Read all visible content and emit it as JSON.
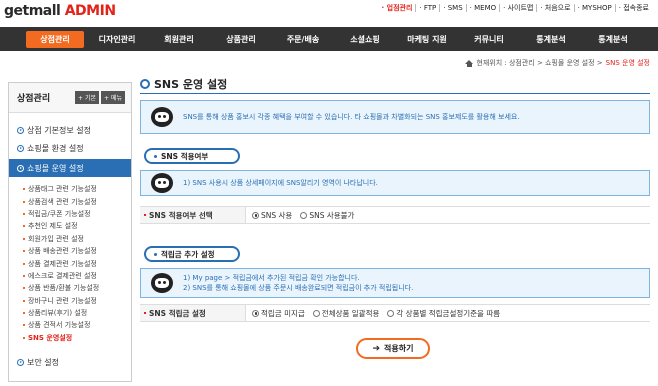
{
  "logo": {
    "part1": "getmall",
    "part2": "ADMIN"
  },
  "top_links": [
    "· 업점관리",
    "· FTP",
    "· SMS",
    "· MEMO",
    "· 사이트맵",
    "· 처음으로",
    "· MYSHOP",
    "· 접속종료"
  ],
  "nav": [
    "상점관리",
    "디자인관리",
    "회원관리",
    "상품관리",
    "주문/배송",
    "소셜쇼핑",
    "마케팅 지원",
    "커뮤니티",
    "통계분석",
    "통계분석"
  ],
  "breadcrumb": {
    "prefix": "현재위치 : 상점관리 > 쇼핑몰 운영 설정 > ",
    "current": "SNS 운영 설정"
  },
  "sidebar": {
    "title": "상점관리",
    "btn1": "+ 기본",
    "btn2": "+ 메뉴",
    "items": [
      "상점 기본정보 설정",
      "쇼핑몰 환경 설정",
      "쇼핑몰 운영 설정"
    ],
    "sub_items": [
      "상품태그 관련 기능설정",
      "상품검색 관련 기능설정",
      "적립금/쿠폰 기능설정",
      "추천인 제도 설정",
      "회원가입 관련 설정",
      "상품 배송관련 기능설정",
      "상품 결제관련 기능설정",
      "에스크로 결제관련 설정",
      "상품 반품/환불 기능설정",
      "장바구니 관련 기능설정",
      "상품리뷰(후기) 설정",
      "상품 견적서 기능설정",
      "SNS 운영설정"
    ],
    "bottom": "보안 설정"
  },
  "main": {
    "title": "SNS 운영 설정",
    "intro": "SNS를 통해 상품 홍보시 각종 혜택을 부여할 수 있습니다. 타 쇼핑몰과 차별화되는 SNS 홍보제도를 활용해 보세요.",
    "section1": {
      "title": "SNS 적용여부",
      "info": "1) SNS 사용시 상품 상세페이지에 SNS알리기 영역이 나타납니다.",
      "label": "SNS 적용여부 선택",
      "options": [
        "SNS 사용",
        "SNS 사용불가"
      ],
      "selected": 0
    },
    "section2": {
      "title": "적립금 추가 설정",
      "info1": "1) My page > 적립금에서 추가된 적립금 확인 가능합니다.",
      "info2": "2) SNS를 통해 쇼핑몰에 상품 주문시 배송완료되면 적립금이 추가 적립됩니다.",
      "label": "SNS 적립금 설정",
      "options": [
        "적립금 미지급",
        "전체상품 일괄적용",
        "각 상품별 적립금설정기준을 따름"
      ],
      "selected": 0
    },
    "apply_label": "적용하기"
  }
}
